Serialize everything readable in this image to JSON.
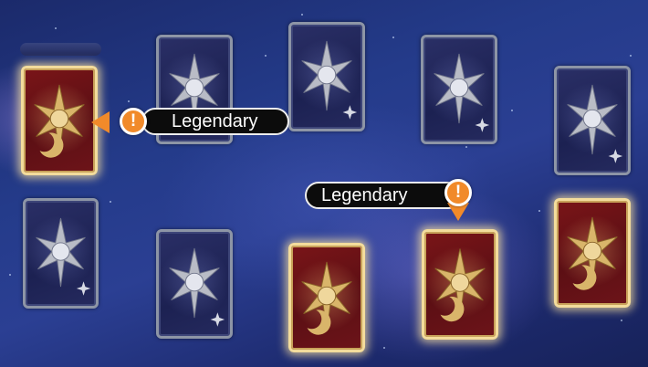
{
  "board": {
    "cards": [
      {
        "id": "r1c1",
        "rarity": "legendary"
      },
      {
        "id": "r1c2",
        "rarity": "common"
      },
      {
        "id": "r1c3",
        "rarity": "common"
      },
      {
        "id": "r1c4",
        "rarity": "common"
      },
      {
        "id": "r1c5",
        "rarity": "common"
      },
      {
        "id": "r2c1",
        "rarity": "common"
      },
      {
        "id": "r2c2",
        "rarity": "common"
      },
      {
        "id": "r2c3",
        "rarity": "legendary"
      },
      {
        "id": "r2c4",
        "rarity": "legendary"
      },
      {
        "id": "r2c5",
        "rarity": "legendary"
      }
    ]
  },
  "callouts": [
    {
      "badge_glyph": "!",
      "label": "Legendary",
      "target": "r1c1"
    },
    {
      "badge_glyph": "!",
      "label": "Legendary",
      "target": "r2c4"
    }
  ],
  "colors": {
    "legendary_border": "#f3dc9c",
    "legendary_face": "#6d1419",
    "common_border": "#8d95a6",
    "common_face": "#1c2152",
    "badge": "#f18a2a",
    "label_bg": "#0c0c0c"
  },
  "icons": {
    "card_emblem": "sun-star-emblem-icon",
    "badge": "exclamation-icon"
  }
}
